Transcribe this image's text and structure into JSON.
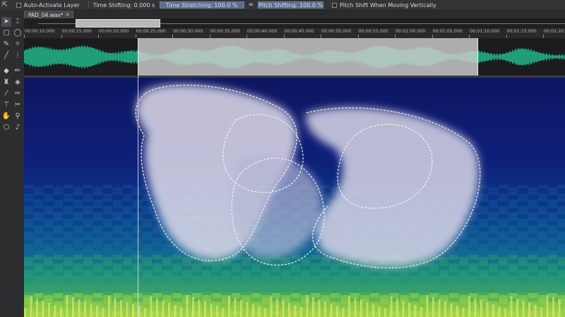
{
  "toolbar": {
    "auto_activate_label": "Auto-Activate Layer",
    "time_shifting_label": "Time Shifting: 0.000 s",
    "time_stretching_label": "Time Stretching: 100.0 %",
    "pitch_shifting_label": "Pitch Shifting: 100.0 %",
    "pitch_shift_vertical_label": "Pitch Shift When Moving Vertically"
  },
  "tab": {
    "title": "PAD_04.wav*",
    "close_glyph": "×"
  },
  "ruler": {
    "ticks": [
      "00:00:10.000",
      "00:00:15.000",
      "00:00:20.000",
      "00:00:25.000",
      "00:00:30.000",
      "00:00:35.000",
      "00:00:40.000",
      "00:00:45.000",
      "00:00:50.000",
      "00:00:55.000",
      "00:01:00.000",
      "00:01:05.000",
      "00:01:10.000",
      "00:01:15.000",
      "00:01:20.000"
    ]
  },
  "tools": [
    "pointer-icon",
    "time-selection-icon",
    "rectangle-select-icon",
    "lasso-icon",
    "brush-select-icon",
    "magic-wand-icon",
    "line-icon",
    "frequency-select-icon",
    "eraser-icon",
    "pencil-icon",
    "stamp-icon",
    "fill-icon",
    "brush-icon",
    "smudge-icon",
    "cut-icon",
    "scissors-icon",
    "text-icon",
    "transform-icon",
    "hand-icon",
    "zoom-icon",
    "cube-icon",
    "speaker-icon"
  ],
  "colors": {
    "accent": "#5b6f8c",
    "waveform": "#1f9e77",
    "spectrum_low": "#0c1a6b",
    "spectrum_high": "#d8e84a",
    "selection": "#d4d4da"
  }
}
